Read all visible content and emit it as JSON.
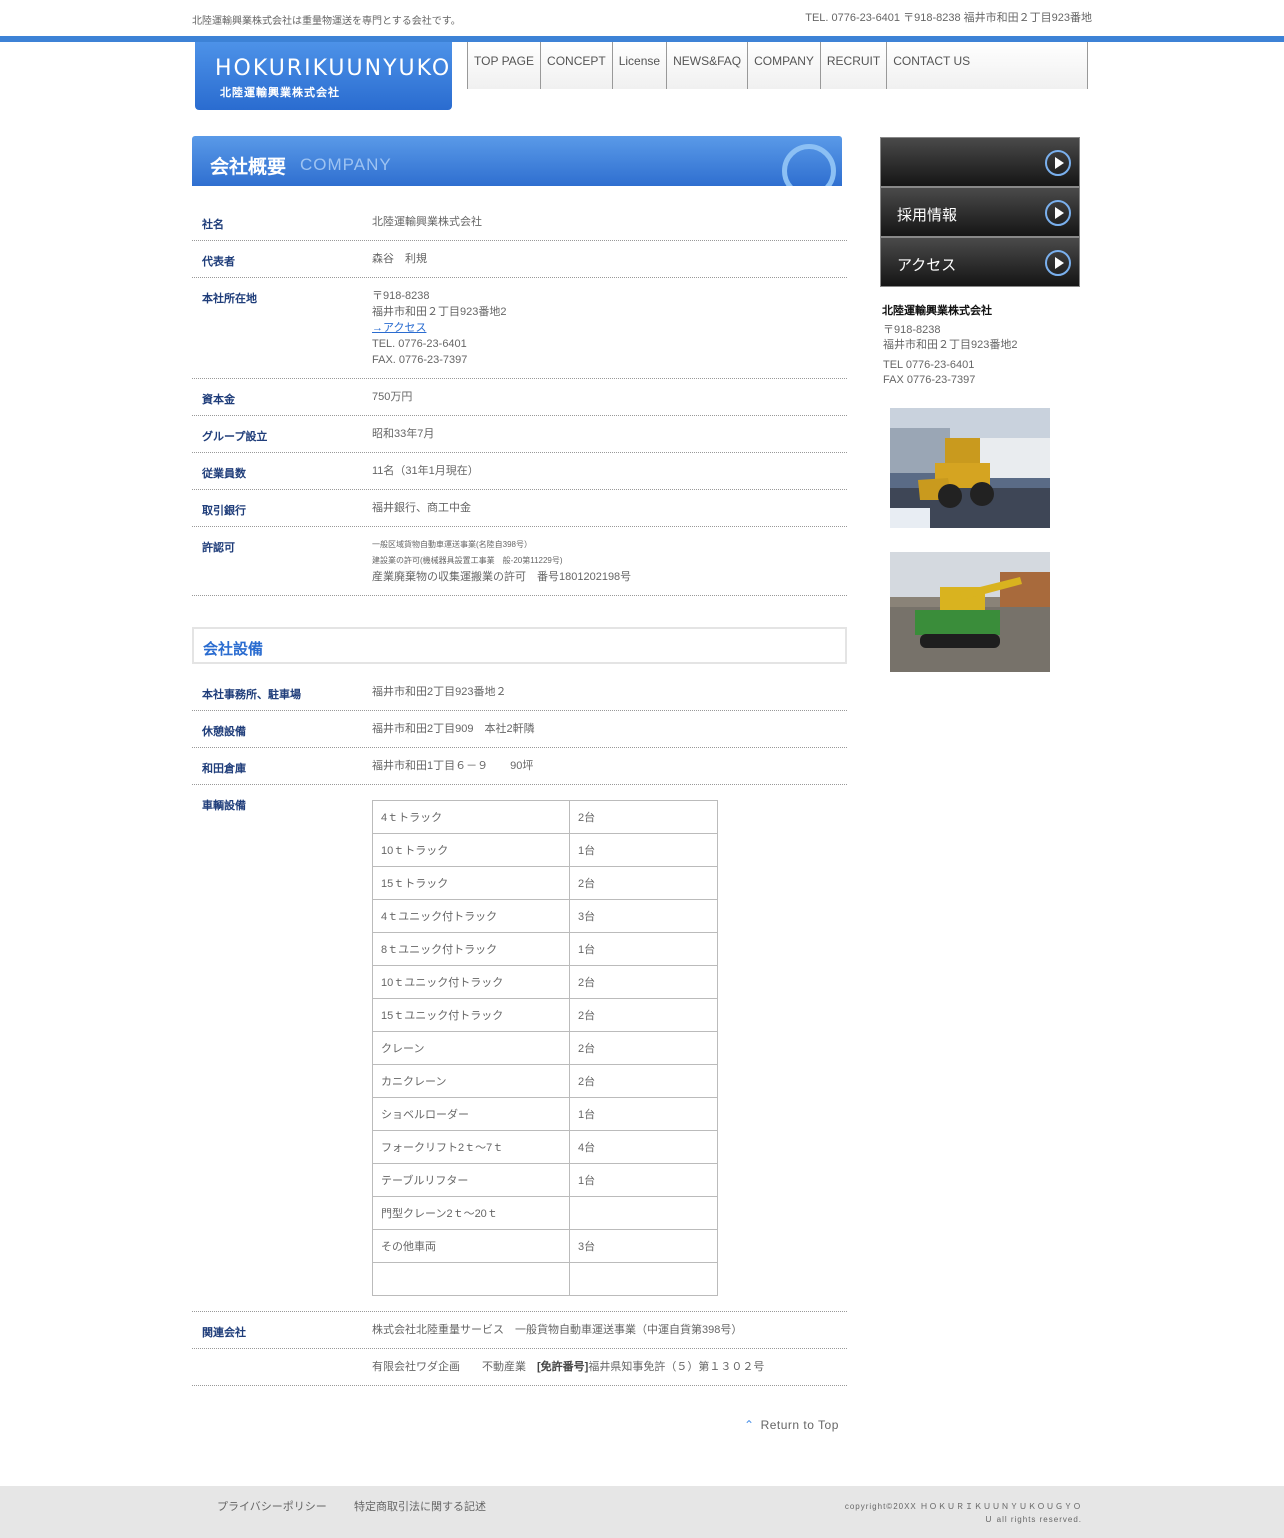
{
  "header": {
    "tagline": "北陸運輸興業株式会社は重量物運送を専門とする会社です。",
    "contact": "TEL. 0776-23-6401 〒918-8238 福井市和田２丁目923番地",
    "logo_en": "HOKURIKUUNYUKOUGYO",
    "logo_ja": "北陸運輸興業株式会社"
  },
  "nav": [
    "TOP PAGE",
    "CONCEPT",
    "License",
    "NEWS&FAQ",
    "COMPANY",
    "RECRUIT",
    "CONTACT US"
  ],
  "section": {
    "title_ja": "会社概要",
    "title_en": "COMPANY"
  },
  "profile": {
    "company_label": "社名",
    "company_value": "北陸運輸興業株式会社",
    "rep_label": "代表者",
    "rep_value": "森谷　利規",
    "hq_label": "本社所在地",
    "hq_zip": "〒918-8238",
    "hq_addr": "福井市和田２丁目923番地2",
    "hq_access": "→アクセス",
    "hq_tel": "TEL. 0776-23-6401",
    "hq_fax": "FAX. 0776-23-7397",
    "capital_label": "資本金",
    "capital_value": "750万円",
    "founded_label": "グループ設立",
    "founded_value": "昭和33年7月",
    "staff_label": "従業員数",
    "staff_value": "11名（31年1月現在）",
    "bank_label": "取引銀行",
    "bank_value": "福井銀行、商工中金",
    "license_label": "許認可",
    "license_1": "一般区域貨物自動車運送事業(名陸自398号）",
    "license_2": "建設業の許可(機械器具設置工事業　般-20第11229号)",
    "license_3": "産業廃棄物の収集運搬業の許可　番号1801202198号"
  },
  "facilities": {
    "title": "会社設備",
    "office_label": "本社事務所、駐車場",
    "office_value": "福井市和田2丁目923番地２",
    "rest_label": "休憩設備",
    "rest_value": "福井市和田2丁目909　本社2軒隣",
    "warehouse_label": "和田倉庫",
    "warehouse_value": "福井市和田1丁目６－９　　90坪",
    "vehicles_label": "車輌設備",
    "vehicles": [
      {
        "name": "4ｔトラック",
        "count": "2台"
      },
      {
        "name": "10ｔトラック",
        "count": "1台"
      },
      {
        "name": "15ｔトラック",
        "count": "2台"
      },
      {
        "name": "4ｔユニック付トラック",
        "count": "3台"
      },
      {
        "name": "8ｔユニック付トラック",
        "count": "1台"
      },
      {
        "name": "10ｔユニック付トラック",
        "count": "2台"
      },
      {
        "name": "15ｔユニック付トラック",
        "count": "2台"
      },
      {
        "name": "クレーン",
        "count": "2台"
      },
      {
        "name": "カニクレーン",
        "count": "2台"
      },
      {
        "name": "ショベルローダー",
        "count": "1台"
      },
      {
        "name": "フォークリフト2ｔ～7ｔ",
        "count": "4台"
      },
      {
        "name": " テーブルリフター",
        "count": " 1台"
      },
      {
        "name": "門型クレーン2ｔ～20ｔ",
        "count": ""
      },
      {
        "name": " その他車両",
        "count": " 3台"
      },
      {
        "name": "",
        "count": ""
      }
    ],
    "related_label": "関連会社",
    "related_1": "株式会社北陸重量サービス　一般貨物自動車運送事業（中運自貨第398号）",
    "related_2_pre": "有限会社ワダ企画　　不動産業　",
    "related_2_bold": "[免許番号]",
    "related_2_post": "福井県知事免許（５）第１３０２号"
  },
  "return_top": "Return to Top",
  "sidebar": {
    "btn_recruit": "採用情報",
    "btn_access": "アクセス",
    "company": "北陸運輸興業株式会社",
    "zip": "〒918-8238",
    "addr": "福井市和田２丁目923番地2",
    "tel": "TEL 0776-23-6401",
    "fax": "FAX 0776-23-7397"
  },
  "footer": {
    "privacy": "プライバシーポリシー",
    "tokutei": "特定商取引法に関する記述",
    "copyright": "copyright©20XX ＨＯＫＵＲＩＫＵＵＮＹＵＫＯＵＧＹＯＵ all rights reserved."
  },
  "colors": {
    "brand_blue": "#3d82d6",
    "label_navy": "#1f3d7a",
    "footer_bg": "#e6e6e6"
  }
}
